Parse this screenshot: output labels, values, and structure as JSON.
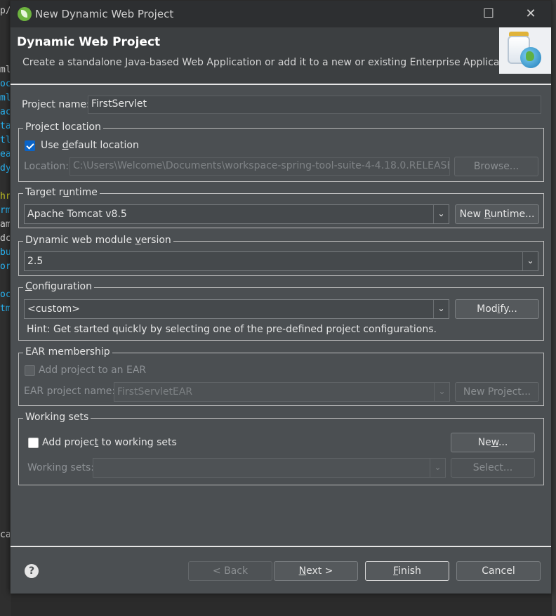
{
  "window": {
    "title": "New Dynamic Web Project",
    "maximize_symbol": "☐",
    "close_symbol": "✕"
  },
  "header": {
    "title": "Dynamic Web Project",
    "description": "Create a standalone Java-based Web Application or add it to a new or existing Enterprise Application."
  },
  "project_name": {
    "label": "Project name:",
    "value": "FirstServlet"
  },
  "project_location": {
    "title": "Project location",
    "use_default_label_pre": "Use ",
    "use_default_label_u": "d",
    "use_default_label_post": "efault location",
    "use_default_checked": true,
    "location_label": "Location:",
    "location_value": "C:\\Users\\Welcome\\Documents\\workspace-spring-tool-suite-4-4.18.0.RELEASE\\Fir",
    "browse_label": "Browse..."
  },
  "target_runtime": {
    "title_pre": "Target r",
    "title_u": "u",
    "title_post": "ntime",
    "value": "Apache Tomcat v8.5",
    "new_runtime_pre": "New ",
    "new_runtime_u": "R",
    "new_runtime_post": "untime..."
  },
  "module_version": {
    "title_pre": "Dynamic web module ",
    "title_u": "v",
    "title_post": "ersion",
    "value": "2.5"
  },
  "configuration": {
    "title_u": "C",
    "title_post": "onfiguration",
    "value": "<custom>",
    "modify_pre": "Mod",
    "modify_u": "i",
    "modify_post": "fy...",
    "hint": "Hint: Get started quickly by selecting one of the pre-defined project configurations."
  },
  "ear": {
    "title": "EAR membership",
    "add_label": "Add project to an EAR",
    "project_name_label": "EAR project name:",
    "project_name_value": "FirstServletEAR",
    "new_project_label": "New Project..."
  },
  "working_sets": {
    "title": "Working sets",
    "add_label_pre": "Add projec",
    "add_label_u": "t",
    "add_label_post": " to working sets",
    "new_pre": "Ne",
    "new_u": "w",
    "new_post": "...",
    "sets_label": "Working sets:",
    "select_label": "Select..."
  },
  "footer": {
    "help_symbol": "?",
    "back_label": "< Back",
    "next_u": "N",
    "next_post": "ext >",
    "finish_u": "F",
    "finish_post": "inish",
    "cancel_label": "Cancel"
  },
  "background": {
    "lines": [
      {
        "text": "p/i",
        "color": "#cfcfcf"
      },
      {
        "text": "ml",
        "color": "#cfcfcf"
      },
      {
        "text": "oc",
        "color": "#29b6f6"
      },
      {
        "text": "ml",
        "color": "#29b6f6"
      },
      {
        "text": "ac",
        "color": "#29b6f6"
      },
      {
        "text": "ta",
        "color": "#29b6f6"
      },
      {
        "text": "tl",
        "color": "#29b6f6"
      },
      {
        "text": "ea",
        "color": "#29b6f6"
      },
      {
        "text": "dy",
        "color": "#29b6f6"
      },
      {
        "text": "hr",
        "color": "#c6c624"
      },
      {
        "text": "rm",
        "color": "#29b6f6"
      },
      {
        "text": "am",
        "color": "#cfcfcf"
      },
      {
        "text": "dc",
        "color": "#cfcfcf"
      },
      {
        "text": "bu",
        "color": "#29b6f6"
      },
      {
        "text": "or",
        "color": "#29b6f6"
      },
      {
        "text": "oc",
        "color": "#29b6f6"
      },
      {
        "text": "tm",
        "color": "#29b6f6"
      },
      {
        "text": "cat",
        "color": "#cfcfcf"
      }
    ]
  }
}
